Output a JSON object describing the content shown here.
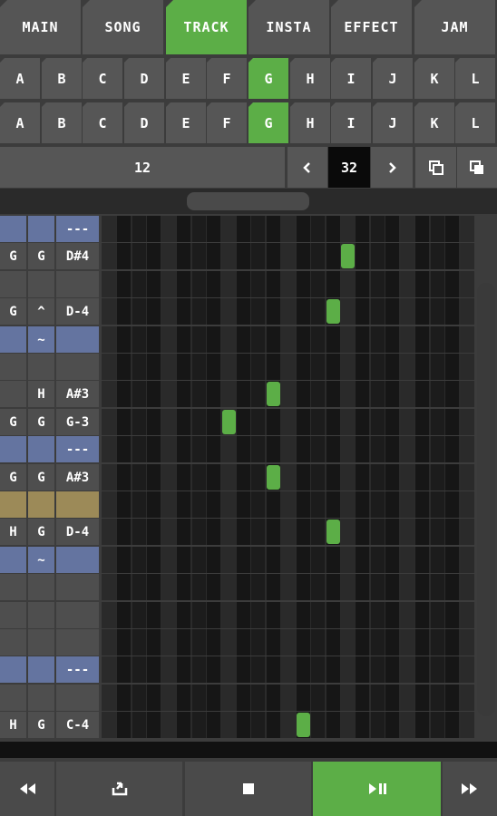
{
  "colors": {
    "accent": "#5cae47",
    "row_blue": "#6474a0",
    "row_gold": "#9c8a58",
    "row_gray": "#4e4e4e",
    "grid_bg": "#1e1e1e"
  },
  "tabs": [
    {
      "label": "MAIN",
      "active": false
    },
    {
      "label": "SONG",
      "active": false
    },
    {
      "label": "TRACK",
      "active": true
    },
    {
      "label": "INSTA",
      "active": false
    },
    {
      "label": "EFFECT",
      "active": false
    },
    {
      "label": "JAM",
      "active": false
    }
  ],
  "pattern_row1": [
    "A",
    "B",
    "C",
    "D",
    "E",
    "F",
    "G",
    "H",
    "I",
    "J",
    "K",
    "L"
  ],
  "pattern_row2": [
    "A",
    "B",
    "C",
    "D",
    "E",
    "F",
    "G",
    "H",
    "I",
    "J",
    "K",
    "L"
  ],
  "selected_pattern_row1": "G",
  "selected_pattern_row2": "G",
  "controls": {
    "position": "12",
    "length": "32",
    "prev_icon": "chevron-left-icon",
    "next_icon": "chevron-right-icon",
    "copy_icon": "copy-icon",
    "paste_icon": "paste-icon"
  },
  "rows": [
    {
      "c1": "",
      "c2": "",
      "c3": "---",
      "color": "blue",
      "note": null
    },
    {
      "c1": "G",
      "c2": "G",
      "c3": "D#4",
      "color": "gray",
      "note": 16
    },
    {
      "c1": "",
      "c2": "",
      "c3": "",
      "color": "gray",
      "note": null
    },
    {
      "c1": "G",
      "c2": "^",
      "c3": "D-4",
      "color": "gray",
      "note": 15
    },
    {
      "c1": "",
      "c2": "~",
      "c3": "",
      "color": "blue",
      "note": null
    },
    {
      "c1": "",
      "c2": "",
      "c3": "",
      "color": "gray",
      "note": null
    },
    {
      "c1": "",
      "c2": "H",
      "c3": "A#3",
      "color": "gray",
      "note": 11
    },
    {
      "c1": "G",
      "c2": "G",
      "c3": "G-3",
      "color": "gray",
      "note": 8
    },
    {
      "c1": "",
      "c2": "",
      "c3": "---",
      "color": "blue",
      "note": null
    },
    {
      "c1": "G",
      "c2": "G",
      "c3": "A#3",
      "color": "gray",
      "note": 11
    },
    {
      "c1": "",
      "c2": "",
      "c3": "",
      "color": "gold",
      "note": null
    },
    {
      "c1": "H",
      "c2": "G",
      "c3": "D-4",
      "color": "gray",
      "note": 15
    },
    {
      "c1": "",
      "c2": "~",
      "c3": "",
      "color": "blue",
      "note": null
    },
    {
      "c1": "",
      "c2": "",
      "c3": "",
      "color": "gray",
      "note": null
    },
    {
      "c1": "",
      "c2": "",
      "c3": "",
      "color": "gray",
      "note": null
    },
    {
      "c1": "",
      "c2": "",
      "c3": "",
      "color": "gray",
      "note": null
    },
    {
      "c1": "",
      "c2": "",
      "c3": "---",
      "color": "blue",
      "note": null
    },
    {
      "c1": "",
      "c2": "",
      "c3": "",
      "color": "gray",
      "note": null
    },
    {
      "c1": "H",
      "c2": "G",
      "c3": "C-4",
      "color": "gray",
      "note": 13
    }
  ],
  "transport": {
    "rewind_icon": "rewind-icon",
    "loop_icon": "loop-icon",
    "stop_icon": "stop-icon",
    "play_pause_icon": "play-pause-icon",
    "fast_forward_icon": "fast-forward-icon"
  }
}
